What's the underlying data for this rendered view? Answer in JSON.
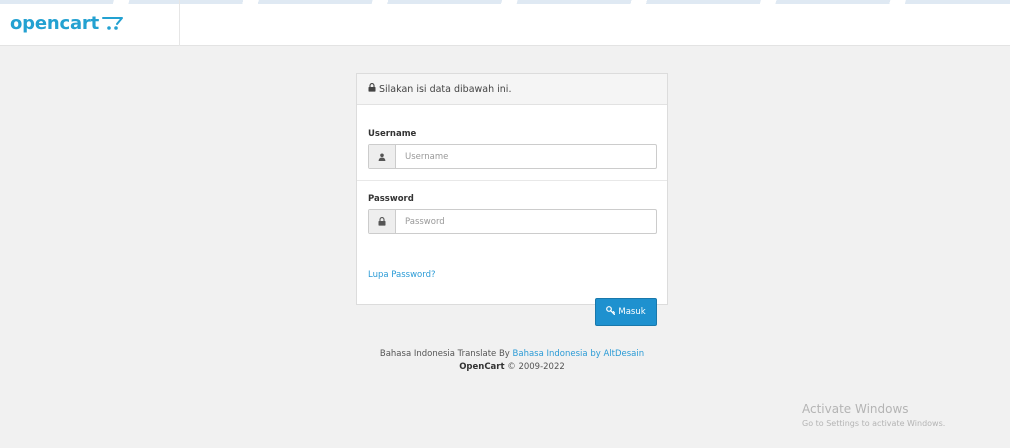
{
  "header": {
    "logo_text": "opencart"
  },
  "login_panel": {
    "heading": "Silakan isi data dibawah ini.",
    "username": {
      "label": "Username",
      "placeholder": "Username",
      "value": ""
    },
    "password": {
      "label": "Password",
      "placeholder": "Password",
      "value": ""
    },
    "forgot_password": "Lupa Password?",
    "login_button": "Masuk"
  },
  "footer": {
    "translate_prefix": "Bahasa Indonesia Translate By",
    "translate_link": "Bahasa Indonesia by AltDesain",
    "brand": "OpenCart",
    "copyright": "© 2009-2022"
  },
  "watermark": {
    "title": "Activate Windows",
    "subtitle": "Go to Settings to activate Windows."
  },
  "colors": {
    "accent": "#23a1d1",
    "button": "#1e91cf",
    "link": "#2b9bd6",
    "background": "#f1f1f1"
  },
  "icons": [
    "cart-icon",
    "lock-icon",
    "user-icon",
    "key-icon"
  ]
}
